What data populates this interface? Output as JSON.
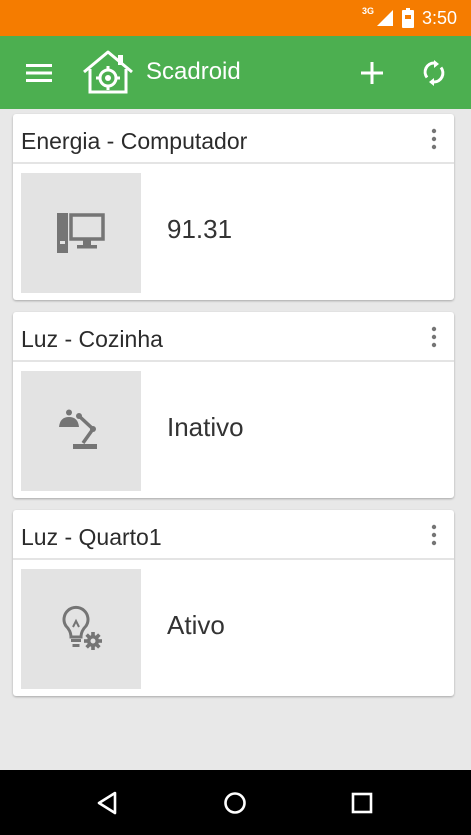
{
  "status_bar": {
    "network_type": "3G",
    "time": "3:50",
    "icons": [
      "signal-icon",
      "battery-icon"
    ]
  },
  "app_bar": {
    "title": "Scadroid",
    "icons": [
      "menu-icon",
      "home-logo-icon",
      "add-icon",
      "refresh-icon"
    ]
  },
  "cards": [
    {
      "title": "Energia - Computador",
      "value": "91.31",
      "icon": "computer-icon"
    },
    {
      "title": "Luz - Cozinha",
      "value": "Inativo",
      "icon": "desk-lamp-icon"
    },
    {
      "title": "Luz - Quarto1",
      "value": "Ativo",
      "icon": "bulb-gear-icon"
    }
  ],
  "nav_bar": {
    "icons": [
      "back-icon",
      "home-icon",
      "recents-icon"
    ]
  },
  "colors": {
    "status_bar": "#f57c00",
    "app_bar": "#4caf50",
    "background": "#e8e8e8",
    "icon_gray": "#757575"
  }
}
